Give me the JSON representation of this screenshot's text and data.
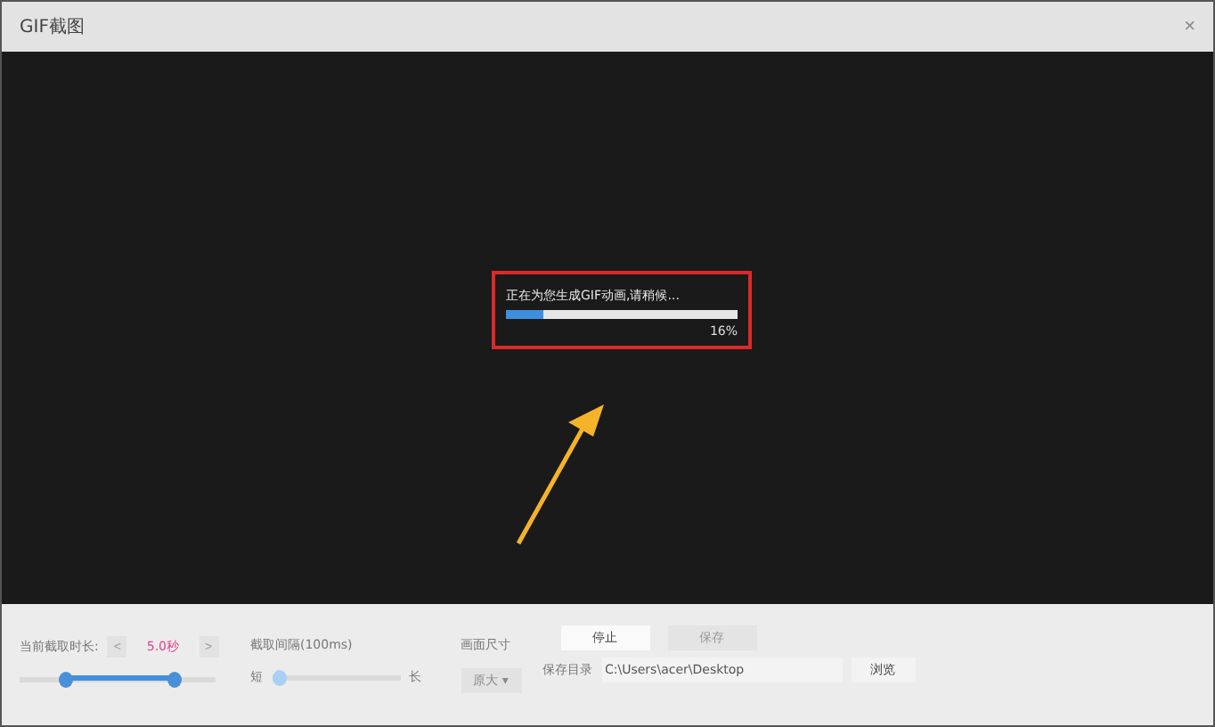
{
  "window": {
    "title": "GIF截图",
    "close": "×"
  },
  "progress": {
    "message": "正在为您生成GIF动画,请稍候...",
    "level": 0.16,
    "percent": "16%"
  },
  "duration": {
    "label": "当前截取时长:",
    "prev": "<",
    "value": "5.0秒",
    "next": ">",
    "thumbs": [
      {
        "level": 0.24
      },
      {
        "level": 0.79
      }
    ]
  },
  "interval": {
    "label": "截取间隔(100ms)",
    "short": "短",
    "long": "长",
    "level": 0.0
  },
  "frame_size": {
    "label": "画面尺寸",
    "value": "原大",
    "caret": "▾",
    "disabled": true
  },
  "buttons": [
    {
      "label": "停止",
      "disabled": false
    },
    {
      "label": "保存",
      "disabled": true
    }
  ],
  "save_dir": {
    "label": "保存目录",
    "value": "C:\\Users\\acer\\Desktop",
    "browse": "浏览"
  }
}
